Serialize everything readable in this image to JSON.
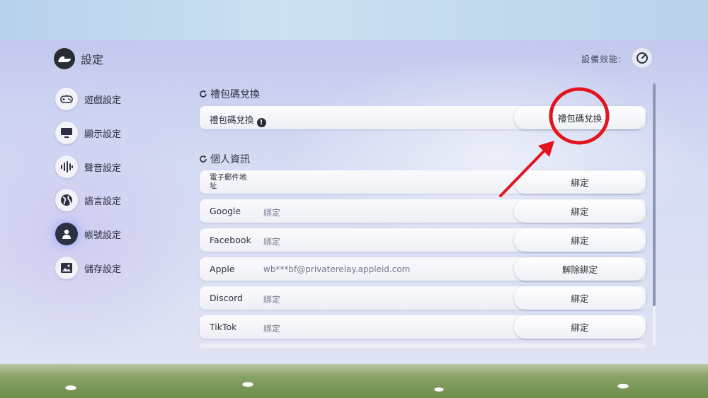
{
  "header": {
    "title": "設定",
    "performance_label": "設備效能:"
  },
  "sidebar": {
    "items": [
      {
        "label": "遊戲設定",
        "icon": "gamepad-icon"
      },
      {
        "label": "顯示設定",
        "icon": "monitor-icon"
      },
      {
        "label": "聲音設定",
        "icon": "soundwave-icon"
      },
      {
        "label": "語言設定",
        "icon": "globe-icon"
      },
      {
        "label": "帳號設定",
        "icon": "user-icon",
        "active": true
      },
      {
        "label": "儲存設定",
        "icon": "image-icon"
      }
    ]
  },
  "gift_section": {
    "title": "禮包碼兌換",
    "row_label": "禮包碼兌換",
    "button": "禮包碼兌換"
  },
  "personal_section": {
    "title": "個人資訊",
    "rows": [
      {
        "label": "電子郵件地址",
        "value": "",
        "button": "綁定"
      },
      {
        "label": "Google",
        "value": "綁定",
        "button": "綁定"
      },
      {
        "label": "Facebook",
        "value": "綁定",
        "button": "綁定"
      },
      {
        "label": "Apple",
        "value": "wb***bf@privaterelay.appleid.com",
        "button": "解除綁定"
      },
      {
        "label": "Discord",
        "value": "綁定",
        "button": "綁定"
      },
      {
        "label": "TikTok",
        "value": "綁定",
        "button": "綁定"
      }
    ]
  },
  "colors": {
    "annotation": "#e4141e",
    "dark": "#2a2c34"
  }
}
